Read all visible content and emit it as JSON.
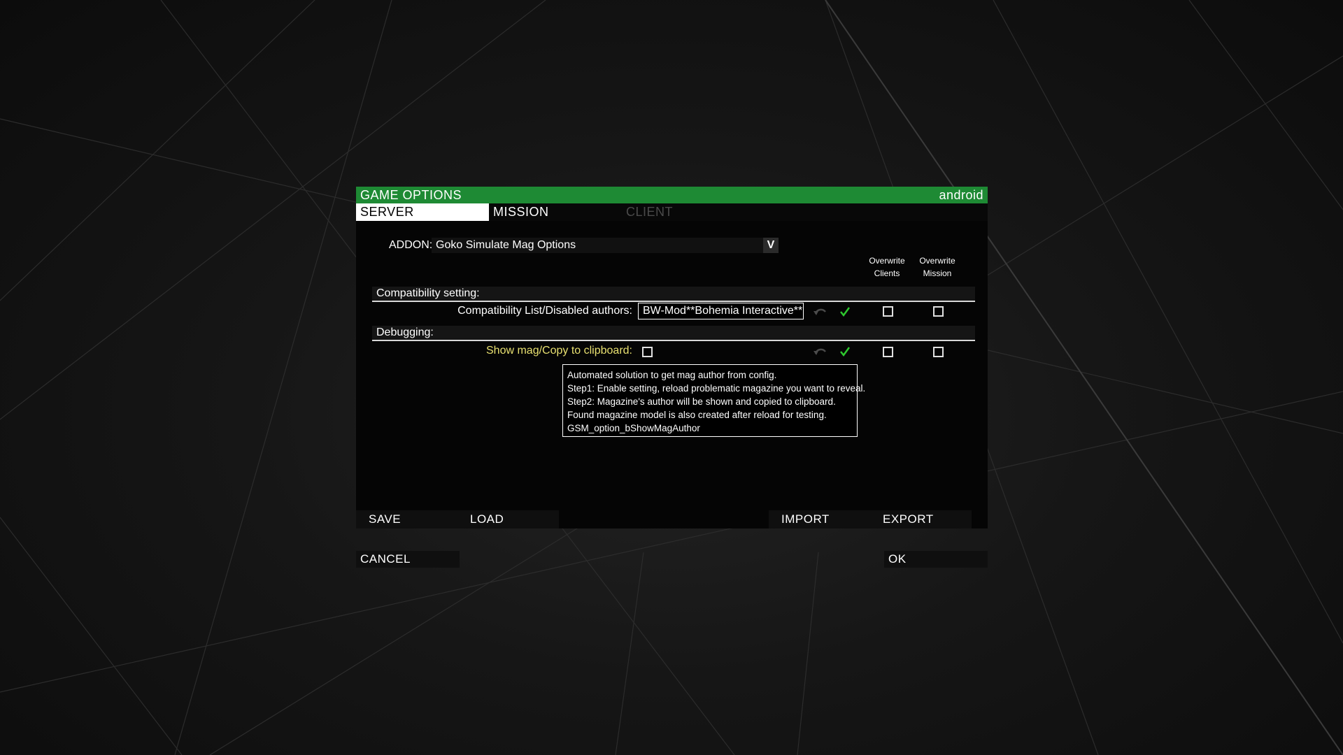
{
  "window": {
    "title": "GAME OPTIONS",
    "profile": "android"
  },
  "tabs": [
    {
      "label": "SERVER",
      "state": "active"
    },
    {
      "label": "MISSION",
      "state": "normal"
    },
    {
      "label": "CLIENT",
      "state": "disabled"
    }
  ],
  "addon": {
    "label": "ADDON:",
    "selected": "Goko Simulate Mag Options",
    "arrow": "V"
  },
  "columns": {
    "overwrite_clients": [
      "Overwrite",
      "Clients"
    ],
    "overwrite_mission": [
      "Overwrite",
      "Mission"
    ]
  },
  "sections": [
    {
      "title": "Compatibility setting:",
      "setting": {
        "label": "Compatibility List/Disabled authors:",
        "value": "BW-Mod**Bohemia Interactive**Ex",
        "label_color": "#ffffff"
      }
    },
    {
      "title": "Debugging:",
      "setting": {
        "label": "Show mag/Copy to clipboard:",
        "checked": false,
        "label_color": "#e8e070"
      }
    }
  ],
  "tooltip": {
    "lines": [
      "Automated solution to get mag author from config.",
      "Step1: Enable setting, reload problematic magazine you want to reveal.",
      "Step2: Magazine's author will be shown and copied to clipboard.",
      "Found magazine model is also created after reload for testing.",
      "GSM_option_bShowMagAuthor"
    ]
  },
  "buttons": {
    "save": "SAVE",
    "load": "LOAD",
    "import": "IMPORT",
    "export": "EXPORT",
    "cancel": "CANCEL",
    "ok": "OK"
  },
  "icons": {
    "undo": "undo-arrow-icon",
    "check": "checkmark-icon"
  },
  "colors": {
    "title_bar": "#1e8a34",
    "check": "#2ec82e",
    "highlight_label": "#e8e070"
  }
}
